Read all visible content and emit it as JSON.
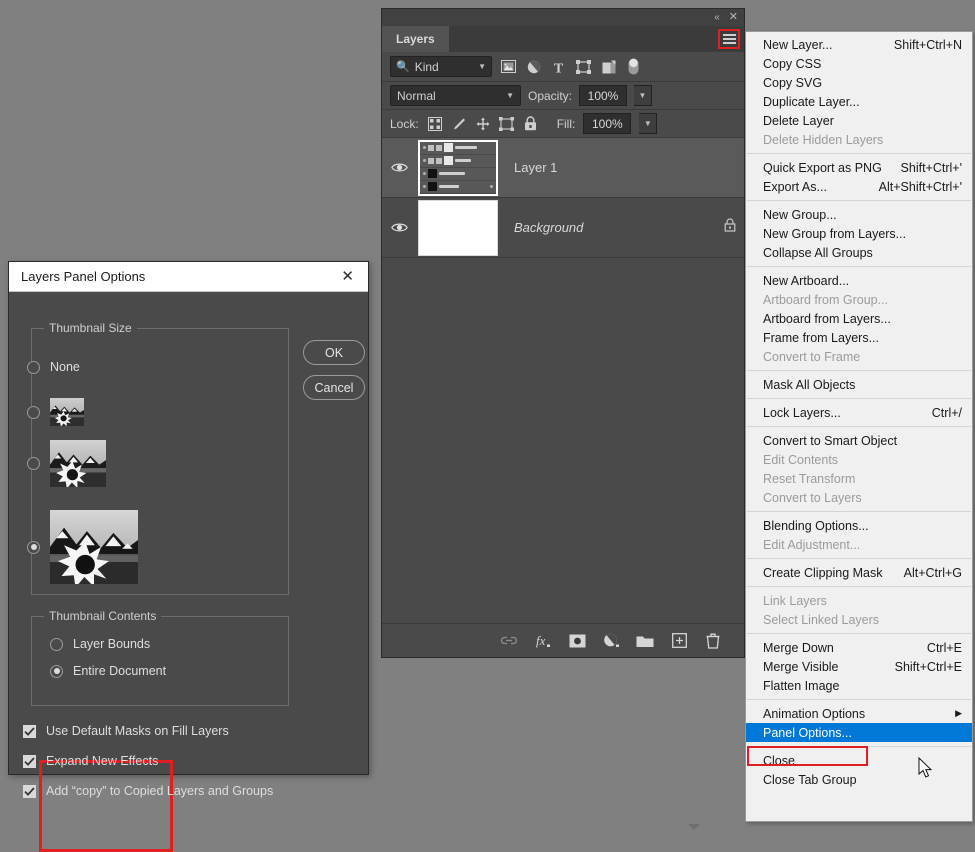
{
  "layers_panel": {
    "titlebar": {
      "collapse_icon": "double-chevron-left-icon",
      "close_icon": "close-icon"
    },
    "tab_label": "Layers",
    "menu_icon": "hamburger-menu-icon",
    "filter": {
      "search_icon": "search-icon",
      "kind_value": "Kind",
      "caret": "chevron-down-icon",
      "type_icons": [
        "image-filter-icon",
        "adjustment-filter-icon",
        "type-filter-icon",
        "shape-filter-icon",
        "smart-object-filter-icon",
        "filter-toggle-switch"
      ]
    },
    "blend": {
      "mode_value": "Normal",
      "opacity_label": "Opacity:",
      "opacity_value": "100%"
    },
    "lock": {
      "lock_label": "Lock:",
      "icons": [
        "lock-transparent-pixels-icon",
        "lock-image-pixels-icon",
        "lock-position-icon",
        "lock-artboard-nesting-icon",
        "lock-all-icon"
      ],
      "fill_label": "Fill:",
      "fill_value": "100%"
    },
    "rows": [
      {
        "name": "Layer 1",
        "visible": true,
        "selected": true,
        "locked": false,
        "italic": false,
        "thumbnail": "layer-stack-screenshot"
      },
      {
        "name": "Background",
        "visible": true,
        "selected": false,
        "locked": true,
        "italic": true,
        "thumbnail": "white-document"
      }
    ],
    "footer_icons": [
      "link-layers-icon",
      "add-layer-style-fx-icon",
      "add-layer-mask-icon",
      "new-adjustment-layer-icon",
      "new-group-icon",
      "new-layer-icon",
      "delete-layer-icon"
    ]
  },
  "context_menu": {
    "highlighted_item": "Panel Options...",
    "groups": [
      [
        {
          "label": "New Layer...",
          "key": "Shift+Ctrl+N",
          "disabled": false
        },
        {
          "label": "Copy CSS",
          "key": "",
          "disabled": false
        },
        {
          "label": "Copy SVG",
          "key": "",
          "disabled": false
        },
        {
          "label": "Duplicate Layer...",
          "key": "",
          "disabled": false
        },
        {
          "label": "Delete Layer",
          "key": "",
          "disabled": false
        },
        {
          "label": "Delete Hidden Layers",
          "key": "",
          "disabled": true
        }
      ],
      [
        {
          "label": "Quick Export as PNG",
          "key": "Shift+Ctrl+'",
          "disabled": false
        },
        {
          "label": "Export As...",
          "key": "Alt+Shift+Ctrl+'",
          "disabled": false
        }
      ],
      [
        {
          "label": "New Group...",
          "key": "",
          "disabled": false
        },
        {
          "label": "New Group from Layers...",
          "key": "",
          "disabled": false
        },
        {
          "label": "Collapse All Groups",
          "key": "",
          "disabled": false
        }
      ],
      [
        {
          "label": "New Artboard...",
          "key": "",
          "disabled": false
        },
        {
          "label": "Artboard from Group...",
          "key": "",
          "disabled": true
        },
        {
          "label": "Artboard from Layers...",
          "key": "",
          "disabled": false
        },
        {
          "label": "Frame from Layers...",
          "key": "",
          "disabled": false
        },
        {
          "label": "Convert to Frame",
          "key": "",
          "disabled": true
        }
      ],
      [
        {
          "label": "Mask All Objects",
          "key": "",
          "disabled": false
        }
      ],
      [
        {
          "label": "Lock Layers...",
          "key": "Ctrl+/",
          "disabled": false
        }
      ],
      [
        {
          "label": "Convert to Smart Object",
          "key": "",
          "disabled": false
        },
        {
          "label": "Edit Contents",
          "key": "",
          "disabled": true
        },
        {
          "label": "Reset Transform",
          "key": "",
          "disabled": true
        },
        {
          "label": "Convert to Layers",
          "key": "",
          "disabled": true
        }
      ],
      [
        {
          "label": "Blending Options...",
          "key": "",
          "disabled": false
        },
        {
          "label": "Edit Adjustment...",
          "key": "",
          "disabled": true
        }
      ],
      [
        {
          "label": "Create Clipping Mask",
          "key": "Alt+Ctrl+G",
          "disabled": false
        }
      ],
      [
        {
          "label": "Link Layers",
          "key": "",
          "disabled": true
        },
        {
          "label": "Select Linked Layers",
          "key": "",
          "disabled": true
        }
      ],
      [
        {
          "label": "Merge Down",
          "key": "Ctrl+E",
          "disabled": false
        },
        {
          "label": "Merge Visible",
          "key": "Shift+Ctrl+E",
          "disabled": false
        },
        {
          "label": "Flatten Image",
          "key": "",
          "disabled": false
        }
      ],
      [
        {
          "label": "Animation Options",
          "key": "",
          "disabled": false,
          "submenu": true
        },
        {
          "label": "Panel Options...",
          "key": "",
          "disabled": false,
          "highlight": true
        }
      ],
      [
        {
          "label": "Close",
          "key": "",
          "disabled": false
        },
        {
          "label": "Close Tab Group",
          "key": "",
          "disabled": false
        }
      ]
    ]
  },
  "dialog": {
    "title": "Layers Panel Options",
    "close_icon": "close-icon",
    "thumbnail_size": {
      "legend": "Thumbnail Size",
      "options": [
        {
          "label": "None",
          "selected": false,
          "size": "none"
        },
        {
          "label": "",
          "selected": false,
          "size": "small"
        },
        {
          "label": "",
          "selected": false,
          "size": "medium"
        },
        {
          "label": "",
          "selected": true,
          "size": "large"
        }
      ]
    },
    "thumbnail_contents": {
      "legend": "Thumbnail Contents",
      "options": [
        {
          "label": "Layer Bounds",
          "selected": false
        },
        {
          "label": "Entire Document",
          "selected": true
        }
      ]
    },
    "checkboxes": [
      {
        "label": "Use Default Masks on Fill Layers",
        "checked": true
      },
      {
        "label": "Expand New Effects",
        "checked": true
      },
      {
        "label": "Add “copy” to Copied Layers and Groups",
        "checked": true
      }
    ],
    "buttons": {
      "ok": "OK",
      "cancel": "Cancel"
    }
  },
  "colors": {
    "canvas_background": "#808080",
    "panel_background": "#4a4a4a",
    "panel_tab_active": "#535353",
    "menu_background": "#f0f0f0",
    "menu_highlight": "#0078d7",
    "annotation_red": "#e02020",
    "text_light": "#dededc",
    "text_dark": "#1a1a1a"
  }
}
